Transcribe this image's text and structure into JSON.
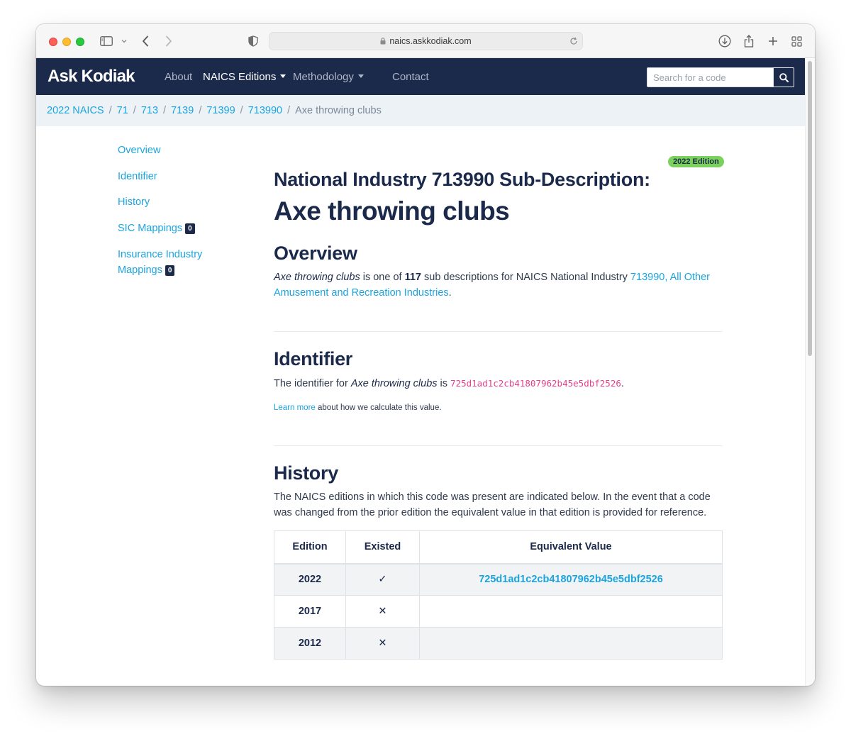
{
  "browser": {
    "url": "naics.askkodiak.com"
  },
  "nav": {
    "brand": "Ask Kodiak",
    "items": [
      {
        "label": "About"
      },
      {
        "label": "NAICS Editions"
      },
      {
        "label": "Methodology"
      },
      {
        "label": "Contact"
      }
    ],
    "search_placeholder": "Search for a code"
  },
  "breadcrumb": {
    "items": [
      "2022 NAICS",
      "71",
      "713",
      "7139",
      "71399",
      "713990"
    ],
    "current": "Axe throwing clubs",
    "separator": "/"
  },
  "sidebar": {
    "items": [
      {
        "label": "Overview"
      },
      {
        "label": "Identifier"
      },
      {
        "label": "History"
      },
      {
        "label": "SIC Mappings",
        "count": "0"
      },
      {
        "label_line1": "Insurance Industry",
        "label_line2": "Mappings",
        "count": "0"
      }
    ]
  },
  "header": {
    "edition_badge": "2022 Edition",
    "subtitle": "National Industry 713990 Sub-Description:",
    "title": "Axe throwing clubs"
  },
  "overview": {
    "heading": "Overview",
    "term": "Axe throwing clubs",
    "text1": " is one of ",
    "count": "117",
    "text2": " sub descriptions for NAICS National Industry ",
    "link": "713990, All Other Amusement and Recreation Industries",
    "text3": "."
  },
  "identifier": {
    "heading": "Identifier",
    "text1": "The identifier for ",
    "term": "Axe throwing clubs",
    "text2": " is ",
    "hash": "725d1ad1c2cb41807962b45e5dbf2526",
    "text3": ".",
    "learn_more": "Learn more",
    "learn_more_rest": " about how we calculate this value."
  },
  "history": {
    "heading": "History",
    "description": "The NAICS editions in which this code was present are indicated below. In the event that a code was changed from the prior edition the equivalent value in that edition is provided for reference.",
    "columns": [
      "Edition",
      "Existed",
      "Equivalent Value"
    ],
    "rows": [
      {
        "edition": "2022",
        "existed": "✓",
        "equivalent": "725d1ad1c2cb41807962b45e5dbf2526"
      },
      {
        "edition": "2017",
        "existed": "✕",
        "equivalent": ""
      },
      {
        "edition": "2012",
        "existed": "✕",
        "equivalent": ""
      }
    ]
  },
  "colors": {
    "navy": "#1b294b",
    "link": "#1aa4e0",
    "badge_green": "#7ad15b",
    "code_pink": "#e83e8c"
  }
}
